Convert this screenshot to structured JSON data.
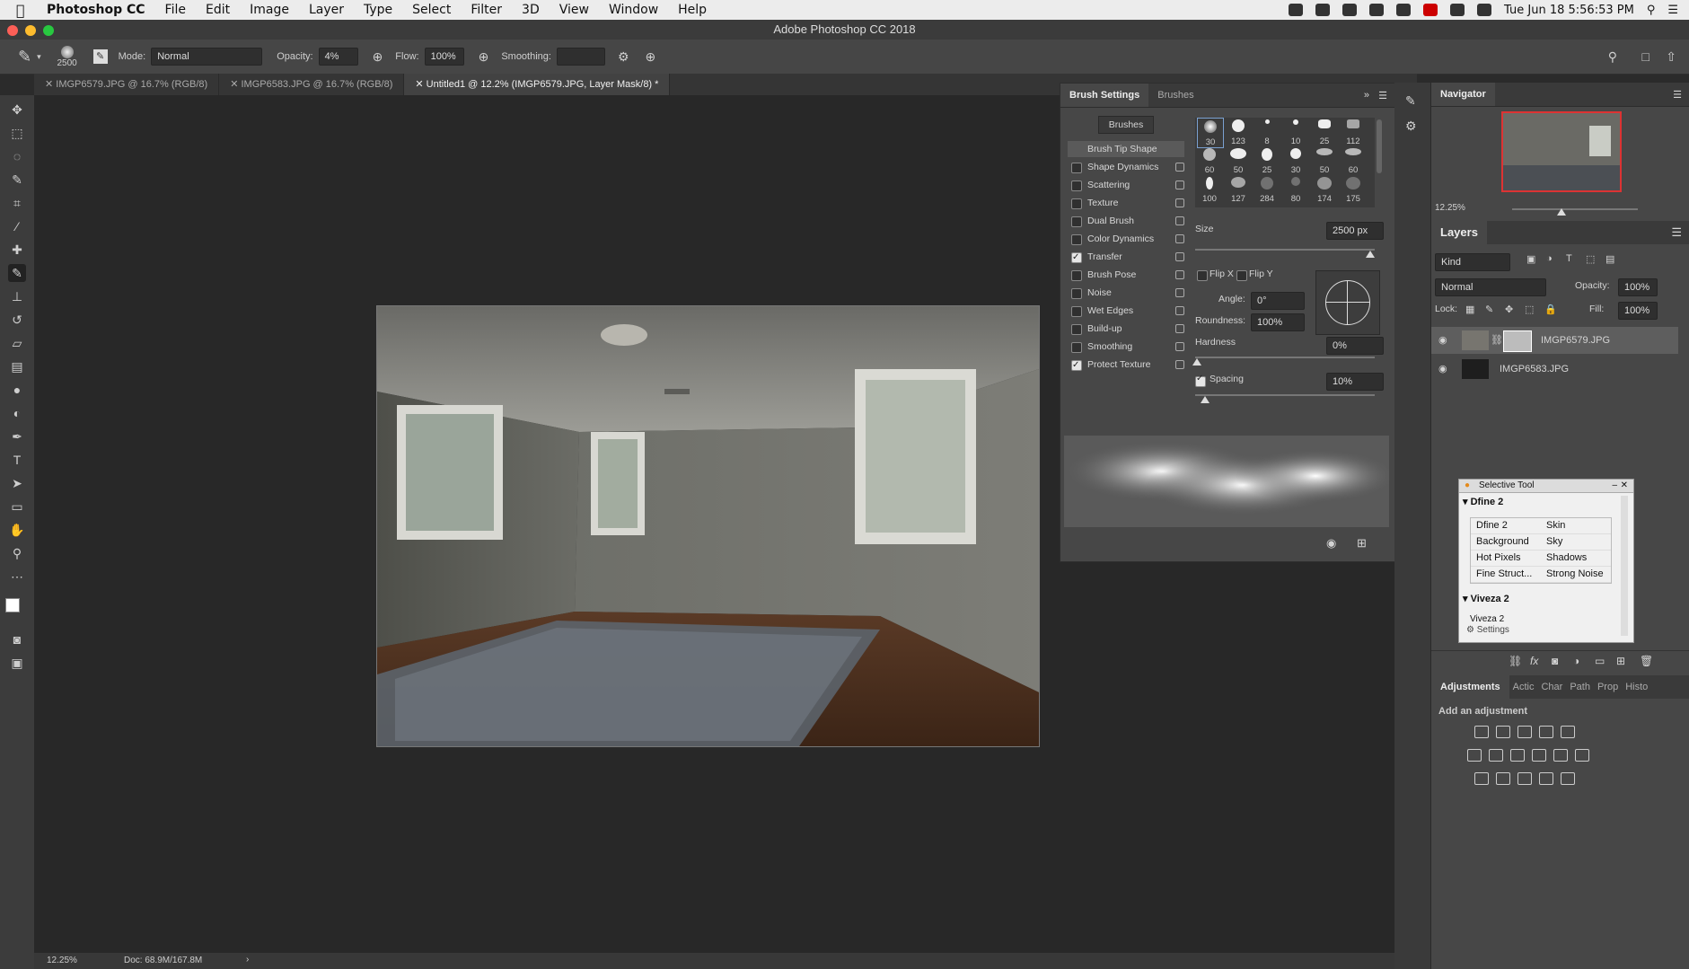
{
  "menubar": {
    "app_name": "Photoshop CC",
    "items": [
      "File",
      "Edit",
      "Image",
      "Layer",
      "Type",
      "Select",
      "Filter",
      "3D",
      "View",
      "Window",
      "Help"
    ],
    "clock": "Tue Jun 18  5:56:53 PM"
  },
  "window_title": "Adobe Photoshop CC 2018",
  "options_bar": {
    "brush_size": "2500",
    "mode_label": "Mode:",
    "mode_value": "Normal",
    "opacity_label": "Opacity:",
    "opacity_value": "4%",
    "flow_label": "Flow:",
    "flow_value": "100%",
    "smoothing_label": "Smoothing:",
    "smoothing_value": ""
  },
  "doc_tabs": [
    {
      "label": "IMGP6579.JPG @ 16.7% (RGB/8)"
    },
    {
      "label": "IMGP6583.JPG @ 16.7% (RGB/8)"
    },
    {
      "label": "Untitled1 @ 12.2% (IMGP6579.JPG, Layer Mask/8) *"
    }
  ],
  "status": {
    "zoom": "12.25%",
    "doc": "Doc: 68.9M/167.8M"
  },
  "brush_settings": {
    "tabs": [
      "Brush Settings",
      "Brushes"
    ],
    "brushes_button": "Brushes",
    "tip_shape": "Brush Tip Shape",
    "options": [
      {
        "label": "Shape Dynamics",
        "checked": false
      },
      {
        "label": "Scattering",
        "checked": false
      },
      {
        "label": "Texture",
        "checked": false
      },
      {
        "label": "Dual Brush",
        "checked": false
      },
      {
        "label": "Color Dynamics",
        "checked": false
      },
      {
        "label": "Transfer",
        "checked": true
      },
      {
        "label": "Brush Pose",
        "checked": false
      },
      {
        "label": "Noise",
        "checked": false
      },
      {
        "label": "Wet Edges",
        "checked": false
      },
      {
        "label": "Build-up",
        "checked": false
      },
      {
        "label": "Smoothing",
        "checked": false
      },
      {
        "label": "Protect Texture",
        "checked": true
      }
    ],
    "tip_sizes": [
      "30",
      "123",
      "8",
      "10",
      "25",
      "112",
      "60",
      "50",
      "25",
      "30",
      "50",
      "60",
      "100",
      "127",
      "284",
      "80",
      "174",
      "175"
    ],
    "size_label": "Size",
    "size_value": "2500 px",
    "flip_x": "Flip X",
    "flip_y": "Flip Y",
    "angle_label": "Angle:",
    "angle_value": "0°",
    "roundness_label": "Roundness:",
    "roundness_value": "100%",
    "hardness_label": "Hardness",
    "hardness_value": "0%",
    "spacing_label": "Spacing",
    "spacing_value": "10%"
  },
  "navigator": {
    "title": "Navigator",
    "zoom": "12.25%"
  },
  "layers": {
    "title": "Layers",
    "kind": "Kind",
    "blend_mode": "Normal",
    "opacity_label": "Opacity:",
    "opacity_value": "100%",
    "lock_label": "Lock:",
    "fill_label": "Fill:",
    "fill_value": "100%",
    "items": [
      {
        "name": "IMGP6579.JPG"
      },
      {
        "name": "IMGP6583.JPG"
      }
    ]
  },
  "selective_tool": {
    "title": "Selective Tool",
    "section1": "Dfine 2",
    "grid": [
      [
        "Dfine 2",
        "Skin"
      ],
      [
        "Background",
        "Sky"
      ],
      [
        "Hot Pixels",
        "Shadows"
      ],
      [
        "Fine Struct...",
        "Strong Noise"
      ]
    ],
    "section2": "Viveza 2",
    "sub": "Viveza 2",
    "settings": "Settings"
  },
  "adjustments": {
    "tabs": [
      "Adjustments",
      "Actic",
      "Char",
      "Path",
      "Prop",
      "Histo"
    ],
    "hint": "Add an adjustment"
  }
}
